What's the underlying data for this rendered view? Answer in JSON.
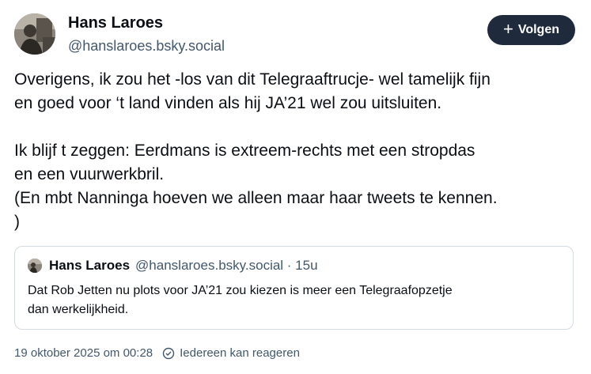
{
  "author": {
    "name": "Hans Laroes",
    "handle": "@hanslaroes.bsky.social"
  },
  "follow_button": {
    "label": "Volgen",
    "icon": "plus-icon"
  },
  "post": {
    "lines_paragraph_1": [
      "Overigens, ik zou het -los van dit Telegraaftrucje- wel tamelijk fijn",
      "en goed voor ‘t land vinden als hij JA’21 wel zou uitsluiten."
    ],
    "lines_paragraph_2": [
      "Ik blijf t zeggen: Eerdmans is extreem-rechts met een stropdas",
      "en een vuurwerkbril.",
      "(En mbt Nanninga hoeven we alleen maar haar tweets te kennen.",
      ")"
    ]
  },
  "quote": {
    "author_name": "Hans Laroes",
    "author_meta": "@hanslaroes.bsky.social · 15u",
    "lines": [
      "Dat Rob Jetten nu plots voor JA’21 zou kiezen is meer een Telegraafopzetje",
      "dan werkelijkheid."
    ]
  },
  "footer": {
    "timestamp": "19 oktober 2025 om 00:28",
    "reply_setting": "Iedereen kan reageren",
    "reply_icon": "globe-icon"
  },
  "colors": {
    "button_bg": "#1f2b3d",
    "secondary_text": "#42576c",
    "border": "#d4dbe2"
  }
}
